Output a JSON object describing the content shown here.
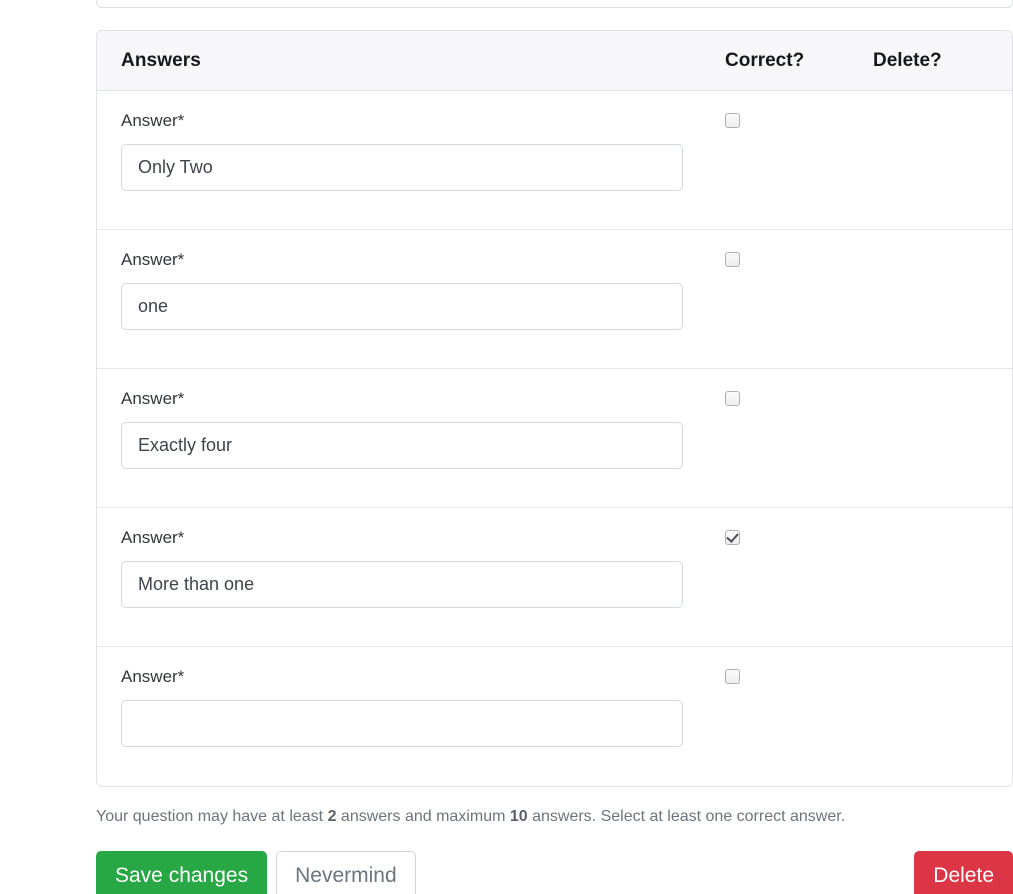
{
  "table": {
    "headers": {
      "answers": "Answers",
      "correct": "Correct?",
      "delete": "Delete?"
    },
    "rows": [
      {
        "label": "Answer*",
        "value": "Only Two",
        "placeholder": "",
        "correct": false
      },
      {
        "label": "Answer*",
        "value": "one",
        "placeholder": "",
        "correct": false
      },
      {
        "label": "Answer*",
        "value": "Exactly four",
        "placeholder": "",
        "correct": false
      },
      {
        "label": "Answer*",
        "value": "More than one",
        "placeholder": "",
        "correct": true
      },
      {
        "label": "Answer*",
        "value": "",
        "placeholder": "",
        "correct": false
      }
    ]
  },
  "help": {
    "part1": "Your question may have at least ",
    "min": "2",
    "part2": " answers and maximum ",
    "max": "10",
    "part3": " answers. Select at least one correct answer."
  },
  "buttons": {
    "save": "Save changes",
    "nevermind": "Nevermind",
    "delete": "Delete"
  },
  "colors": {
    "save": "#28a745",
    "delete": "#dc3545",
    "header_bg": "#f7f7f9",
    "border": "#e0e3e7",
    "muted_text": "#6c757d"
  }
}
